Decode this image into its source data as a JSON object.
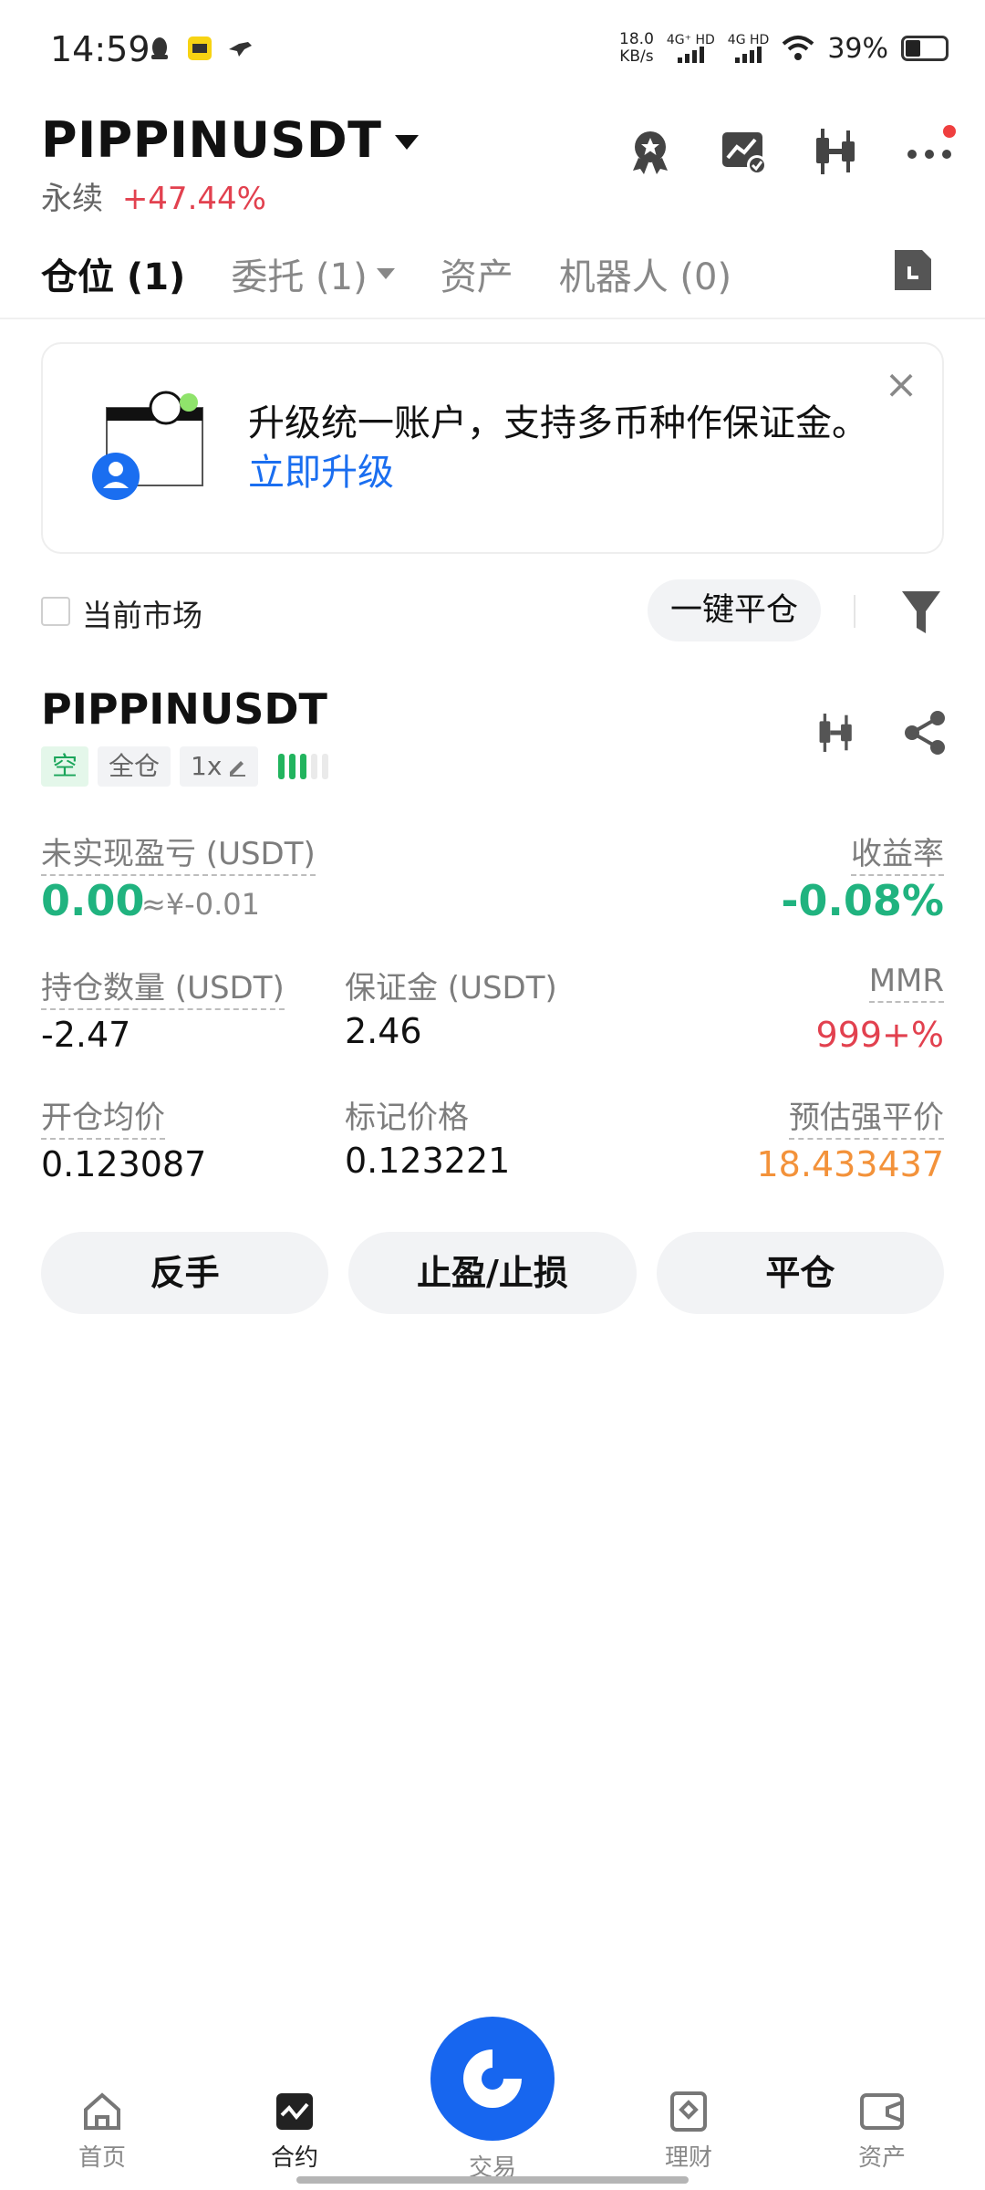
{
  "status_bar": {
    "time": "14:59",
    "speed_value": "18.0",
    "speed_unit": "KB/s",
    "sim1": "4G⁺ HD",
    "sim2": "4G HD",
    "battery": "39%"
  },
  "header": {
    "symbol": "PIPPINUSDT",
    "contract_type": "永续",
    "change": "+47.44%",
    "icons": [
      "award-icon",
      "chart-check-icon",
      "candlestick-icon",
      "more-icon"
    ]
  },
  "tabs": [
    {
      "label": "仓位 (1)",
      "active": true
    },
    {
      "label": "委托 (1)",
      "active": false,
      "dropdown": true
    },
    {
      "label": "资产",
      "active": false
    },
    {
      "label": "机器人 (0)",
      "active": false
    }
  ],
  "banner": {
    "text": "升级统一账户，支持多币种作保证金。",
    "link": "立即升级"
  },
  "filter": {
    "current_market_label": "当前市场",
    "close_all_label": "一键平仓"
  },
  "position": {
    "symbol": "PIPPINUSDT",
    "side_tag": "空",
    "margin_mode_tag": "全仓",
    "leverage_tag": "1x",
    "risk_level": 3,
    "unrealized_pnl_label": "未实现盈亏 (USDT)",
    "unrealized_pnl_value": "0.00",
    "unrealized_pnl_cny": "≈¥-0.01",
    "roe_label": "收益率",
    "roe_value": "-0.08%",
    "size_label": "持仓数量 (USDT)",
    "size_value": "-2.47",
    "margin_label": "保证金 (USDT)",
    "margin_value": "2.46",
    "mmr_label": "MMR",
    "mmr_value": "999+%",
    "entry_price_label": "开仓均价",
    "entry_price_value": "0.123087",
    "mark_price_label": "标记价格",
    "mark_price_value": "0.123221",
    "liq_price_label": "预估强平价",
    "liq_price_value": "18.433437"
  },
  "actions": {
    "reverse": "反手",
    "tp_sl": "止盈/止损",
    "close": "平仓"
  },
  "bottom_nav": {
    "home": "首页",
    "futures": "合约",
    "trade": "交易",
    "earn": "理财",
    "assets": "资产"
  },
  "colors": {
    "green": "#20b37f",
    "red": "#e2414f",
    "orange": "#f3923a",
    "blue": "#1766ef"
  }
}
